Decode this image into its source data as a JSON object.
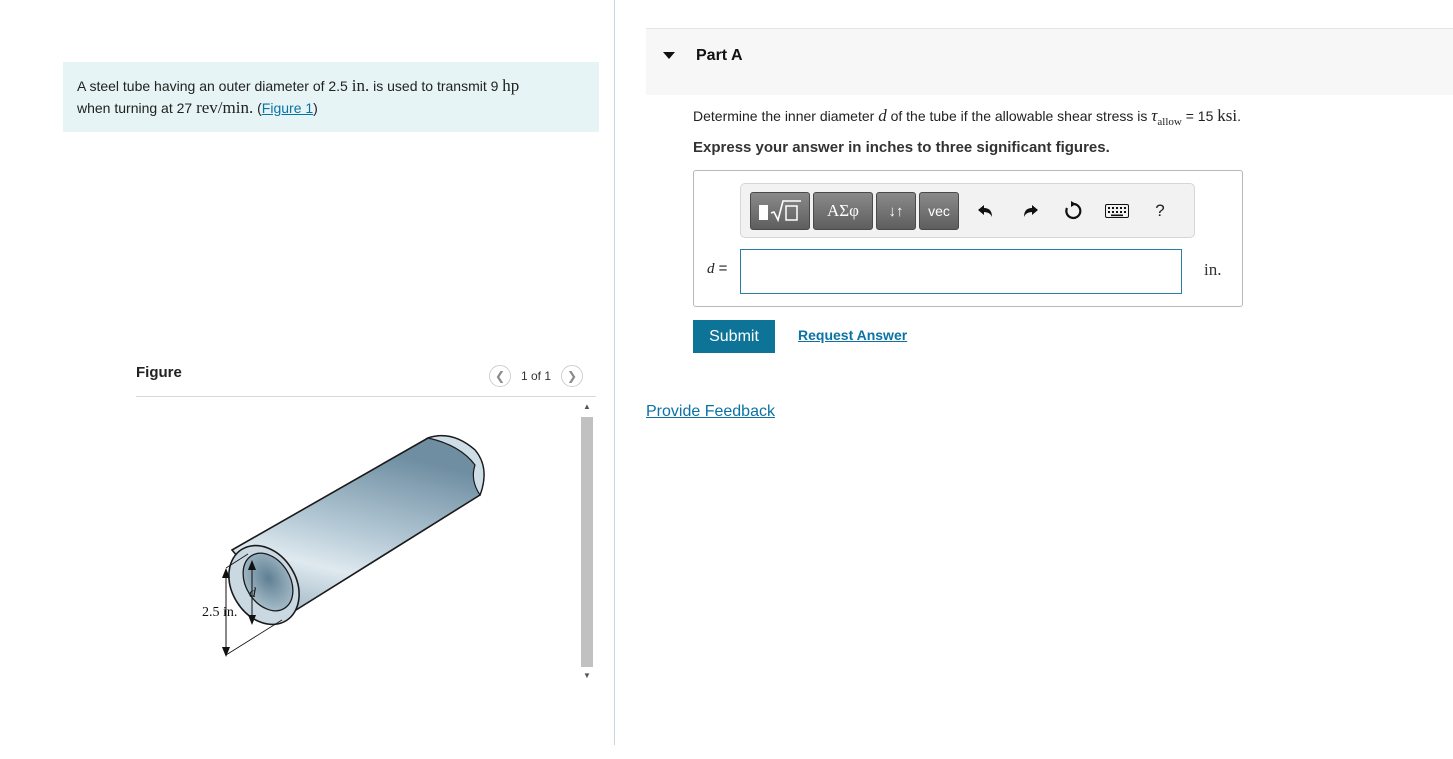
{
  "problem": {
    "text_1": "A steel tube having an outer diameter of 2.5",
    "unit_in": "in.",
    "text_2": "is used to transmit 9",
    "unit_hp": "hp",
    "text_3": "when turning at 27",
    "unit_rev": "rev/min.",
    "figure_link": "Figure 1"
  },
  "figure": {
    "title": "Figure",
    "pager": "1 of 1",
    "label_diameter": "2.5 in.",
    "label_d": "d"
  },
  "part": {
    "title": "Part A",
    "question_1": "Determine the inner diameter",
    "question_var": "d",
    "question_2": "of the tube if the allowable shear stress is",
    "tau": "τ",
    "tau_sub": "allow",
    "question_3": "= 15",
    "question_unit": "ksi",
    "instruction": "Express your answer in inches to three significant figures."
  },
  "toolbar": {
    "greek_label": "ΑΣφ",
    "arrows_label": "↓↑",
    "vec_label": "vec",
    "help_label": "?"
  },
  "answer": {
    "var": "d",
    "equals": " =",
    "value": "",
    "unit": "in."
  },
  "actions": {
    "submit": "Submit",
    "request": "Request Answer",
    "feedback": "Provide Feedback"
  },
  "colors": {
    "accent": "#0d7498",
    "link": "#0b72a5",
    "problem_bg": "#e6f4f5"
  }
}
